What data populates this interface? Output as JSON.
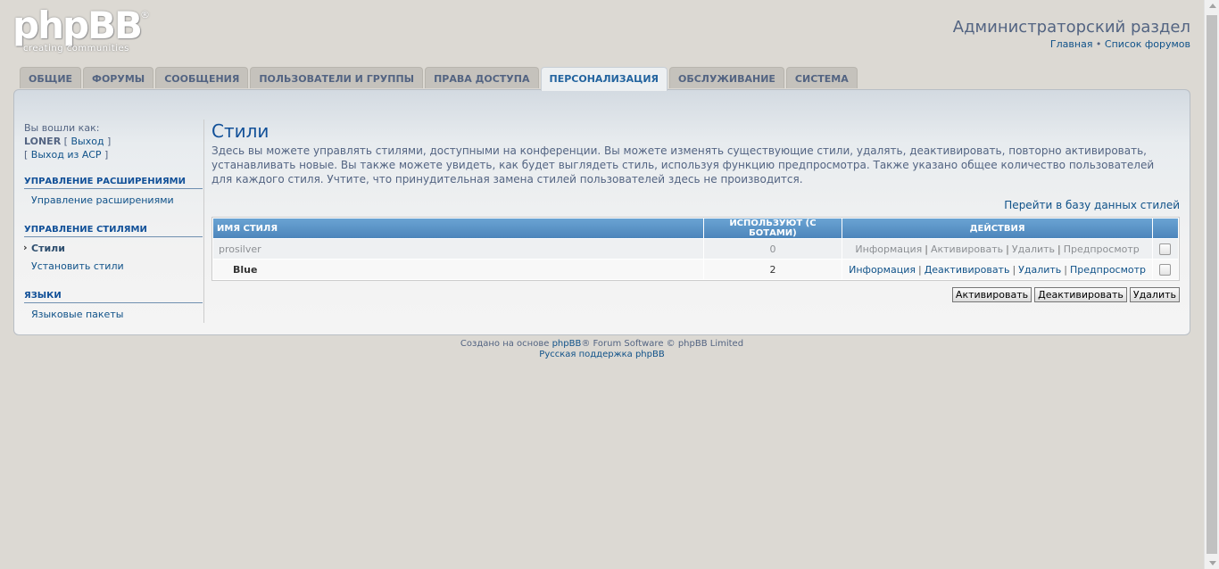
{
  "logo": {
    "word": "phpBB",
    "reg": "®",
    "tagline": "creating communities"
  },
  "header": {
    "title": "Администраторский раздел",
    "links": [
      {
        "label": "Главная"
      },
      {
        "separator": " • "
      },
      {
        "label": "Список форумов"
      }
    ]
  },
  "tabs": [
    {
      "label": "ОБЩИЕ"
    },
    {
      "label": "ФОРУМЫ"
    },
    {
      "label": "СООБЩЕНИЯ"
    },
    {
      "label": "ПОЛЬЗОВАТЕЛИ И ГРУППЫ"
    },
    {
      "label": "ПРАВА ДОСТУПА"
    },
    {
      "label": "ПЕРСОНАЛИЗАЦИЯ",
      "active": true
    },
    {
      "label": "ОБСЛУЖИВАНИЕ"
    },
    {
      "label": "СИСТЕМА"
    }
  ],
  "sidebar": {
    "logged_in_as": "Вы вошли как:",
    "username": "LONER",
    "logout_label": "Выход",
    "acp_logout_label": "Выход из ACP",
    "sections": [
      {
        "title": "УПРАВЛЕНИЕ РАСШИРЕНИЯМИ",
        "items": [
          {
            "label": "Управление расширениями"
          }
        ]
      },
      {
        "title": "УПРАВЛЕНИЕ СТИЛЯМИ",
        "items": [
          {
            "label": "Стили",
            "active": true
          },
          {
            "label": "Установить стили"
          }
        ]
      },
      {
        "title": "ЯЗЫКИ",
        "items": [
          {
            "label": "Языковые пакеты"
          }
        ]
      }
    ]
  },
  "main": {
    "title": "Стили",
    "description": "Здесь вы можете управлять стилями, доступными на конференции. Вы можете изменять существующие стили, удалять, деактивировать, повторно активировать, устанавливать новые. Вы также можете увидеть, как будет выглядеть стиль, используя функцию предпросмотра. Также указано общее количество пользователей для каждого стиля. Учтите, что принудительная замена стилей пользователей здесь не производится.",
    "db_link": "Перейти в базу данных стилей",
    "table": {
      "headers": {
        "name": "ИМЯ СТИЛЯ",
        "users": "ИСПОЛЬЗУЮТ (С БОТАМИ)",
        "actions": "ДЕЙСТВИЯ"
      },
      "rows": [
        {
          "name": "prosilver",
          "users": "0",
          "actions": [
            "Информация",
            "Активировать",
            "Удалить",
            "Предпросмотр"
          ]
        },
        {
          "name": "Blue",
          "users": "2",
          "actions": [
            "Информация",
            "Деактивировать",
            "Удалить",
            "Предпросмотр"
          ]
        }
      ]
    },
    "buttons": {
      "activate": "Активировать",
      "deactivate": "Деактивировать",
      "delete": "Удалить"
    }
  },
  "footer": {
    "prefix": "Создано на основе ",
    "brand": "phpBB",
    "suffix": "® Forum Software © phpBB Limited",
    "support": "Русская поддержка phpBB"
  }
}
